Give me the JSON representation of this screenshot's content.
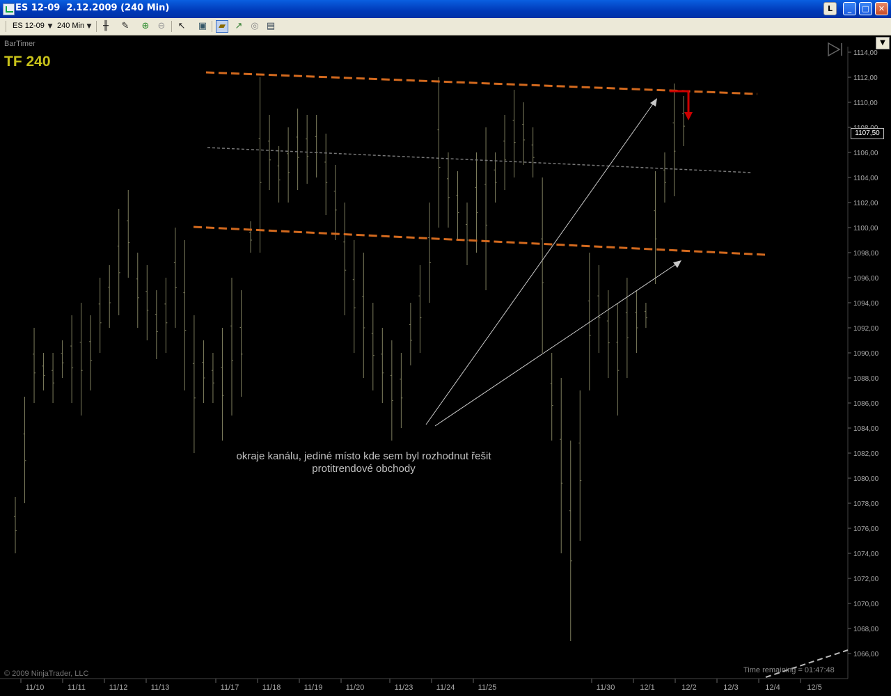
{
  "window": {
    "title": "ES 12-09  2.12.2009 (240 Min)",
    "buttons": {
      "l": "L",
      "minimize": "_",
      "maximize": "□",
      "close": "✕"
    }
  },
  "toolbar": {
    "instrument": "ES 12-09",
    "interval": "240 Min",
    "icons": [
      "bar-style-icon",
      "pencil-icon",
      "zoom-in-icon",
      "zoom-out-icon",
      "pointer-icon",
      "properties-icon",
      "instrument-icon",
      "indicator-icon",
      "strategy-icon",
      "data-box-icon"
    ]
  },
  "chart": {
    "indicator_label": "BarTimer",
    "timeframe_label": "TF 240",
    "copyright": "© 2009 NinjaTrader, LLC",
    "time_remaining": "Time remaining = 01:47:48",
    "last_price": "1107,50",
    "annotation_line1": "okraje kanálu, jediné místo kde sem byl rozhodnut řešit",
    "annotation_line2": "protitrendové obchody",
    "y_ticks": [
      "1114,00",
      "1112,00",
      "1110,00",
      "1108,00",
      "1106,00",
      "1104,00",
      "1102,00",
      "1100,00",
      "1098,00",
      "1096,00",
      "1094,00",
      "1092,00",
      "1090,00",
      "1088,00",
      "1086,00",
      "1084,00",
      "1082,00",
      "1080,00",
      "1078,00",
      "1076,00",
      "1074,00",
      "1072,00",
      "1070,00",
      "1068,00",
      "1066,00"
    ],
    "x_ticks": [
      "11/10",
      "11/11",
      "11/12",
      "11/13",
      "11/17",
      "11/18",
      "11/19",
      "11/20",
      "11/23",
      "11/24",
      "11/25",
      "11/30",
      "12/1",
      "12/2",
      "12/3",
      "12/4",
      "12/5"
    ]
  },
  "chart_data": {
    "type": "ohlc",
    "ylim": [
      1065,
      1115
    ],
    "bars": [
      {
        "h": 1078.5,
        "l": 1074.0
      },
      {
        "h": 1086.5,
        "l": 1078.0
      },
      {
        "h": 1092.0,
        "l": 1086.0
      },
      {
        "h": 1090.0,
        "l": 1087.0
      },
      {
        "h": 1090.0,
        "l": 1086.0
      },
      {
        "h": 1091.0,
        "l": 1088.0
      },
      {
        "h": 1093.0,
        "l": 1086.0
      },
      {
        "h": 1094.0,
        "l": 1085.0
      },
      {
        "h": 1093.0,
        "l": 1087.0
      },
      {
        "h": 1096.0,
        "l": 1090.0
      },
      {
        "h": 1097.0,
        "l": 1092.0
      },
      {
        "h": 1101.5,
        "l": 1093.0
      },
      {
        "h": 1103.0,
        "l": 1096.0
      },
      {
        "h": 1098.0,
        "l": 1092.0
      },
      {
        "h": 1097.0,
        "l": 1091.0
      },
      {
        "h": 1095.0,
        "l": 1089.5
      },
      {
        "h": 1096.0,
        "l": 1090.0
      },
      {
        "h": 1100.0,
        "l": 1092.0
      },
      {
        "h": 1099.0,
        "l": 1087.0
      },
      {
        "h": 1093.0,
        "l": 1082.0
      },
      {
        "h": 1091.0,
        "l": 1086.0
      },
      {
        "h": 1090.0,
        "l": 1086.0
      },
      {
        "h": 1092.0,
        "l": 1083.0
      },
      {
        "h": 1096.0,
        "l": 1085.0
      },
      {
        "h": 1095.0,
        "l": 1086.5
      },
      {
        "h": 1100.5,
        "l": 1098.0
      },
      {
        "h": 1112.0,
        "l": 1098.0
      },
      {
        "h": 1109.0,
        "l": 1103.0
      },
      {
        "h": 1106.5,
        "l": 1102.0
      },
      {
        "h": 1108.0,
        "l": 1102.0
      },
      {
        "h": 1109.5,
        "l": 1103.0
      },
      {
        "h": 1109.0,
        "l": 1103.5
      },
      {
        "h": 1109.0,
        "l": 1104.0
      },
      {
        "h": 1107.5,
        "l": 1101.0
      },
      {
        "h": 1105.0,
        "l": 1099.0
      },
      {
        "h": 1102.0,
        "l": 1093.0
      },
      {
        "h": 1099.0,
        "l": 1090.0
      },
      {
        "h": 1098.0,
        "l": 1088.0
      },
      {
        "h": 1094.0,
        "l": 1087.0
      },
      {
        "h": 1092.0,
        "l": 1086.0
      },
      {
        "h": 1091.0,
        "l": 1083.0
      },
      {
        "h": 1090.0,
        "l": 1084.0
      },
      {
        "h": 1094.0,
        "l": 1089.0
      },
      {
        "h": 1097.0,
        "l": 1090.0
      },
      {
        "h": 1102.0,
        "l": 1094.0
      },
      {
        "h": 1112.0,
        "l": 1100.0
      },
      {
        "h": 1106.0,
        "l": 1100.0
      },
      {
        "h": 1104.5,
        "l": 1099.0
      },
      {
        "h": 1102.0,
        "l": 1097.0
      },
      {
        "h": 1106.0,
        "l": 1098.0
      },
      {
        "h": 1108.0,
        "l": 1095.0
      },
      {
        "h": 1106.0,
        "l": 1102.0
      },
      {
        "h": 1109.0,
        "l": 1103.0
      },
      {
        "h": 1111.0,
        "l": 1104.0
      },
      {
        "h": 1110.0,
        "l": 1105.0
      },
      {
        "h": 1108.0,
        "l": 1104.0
      },
      {
        "h": 1104.0,
        "l": 1090.0
      },
      {
        "h": 1090.0,
        "l": 1083.0
      },
      {
        "h": 1088.0,
        "l": 1074.0
      },
      {
        "h": 1083.0,
        "l": 1067.0
      },
      {
        "h": 1087.0,
        "l": 1075.0
      },
      {
        "h": 1098.0,
        "l": 1087.0
      },
      {
        "h": 1097.0,
        "l": 1090.0
      },
      {
        "h": 1095.0,
        "l": 1088.0
      },
      {
        "h": 1094.0,
        "l": 1085.0
      },
      {
        "h": 1096.0,
        "l": 1088.0
      },
      {
        "h": 1095.0,
        "l": 1090.0
      },
      {
        "h": 1094.0,
        "l": 1092.0
      },
      {
        "h": 1104.5,
        "l": 1095.5
      },
      {
        "h": 1106.0,
        "l": 1102.0
      },
      {
        "h": 1111.5,
        "l": 1102.5
      },
      {
        "h": 1110.5,
        "l": 1106.5
      }
    ],
    "channel_upper": [
      [
        1111.6,
        1110.5
      ]
    ],
    "channel_lower": [
      [
        1100.0,
        1097.8
      ]
    ],
    "channel_middle": [
      [
        1106.6,
        1104.2
      ]
    ]
  }
}
